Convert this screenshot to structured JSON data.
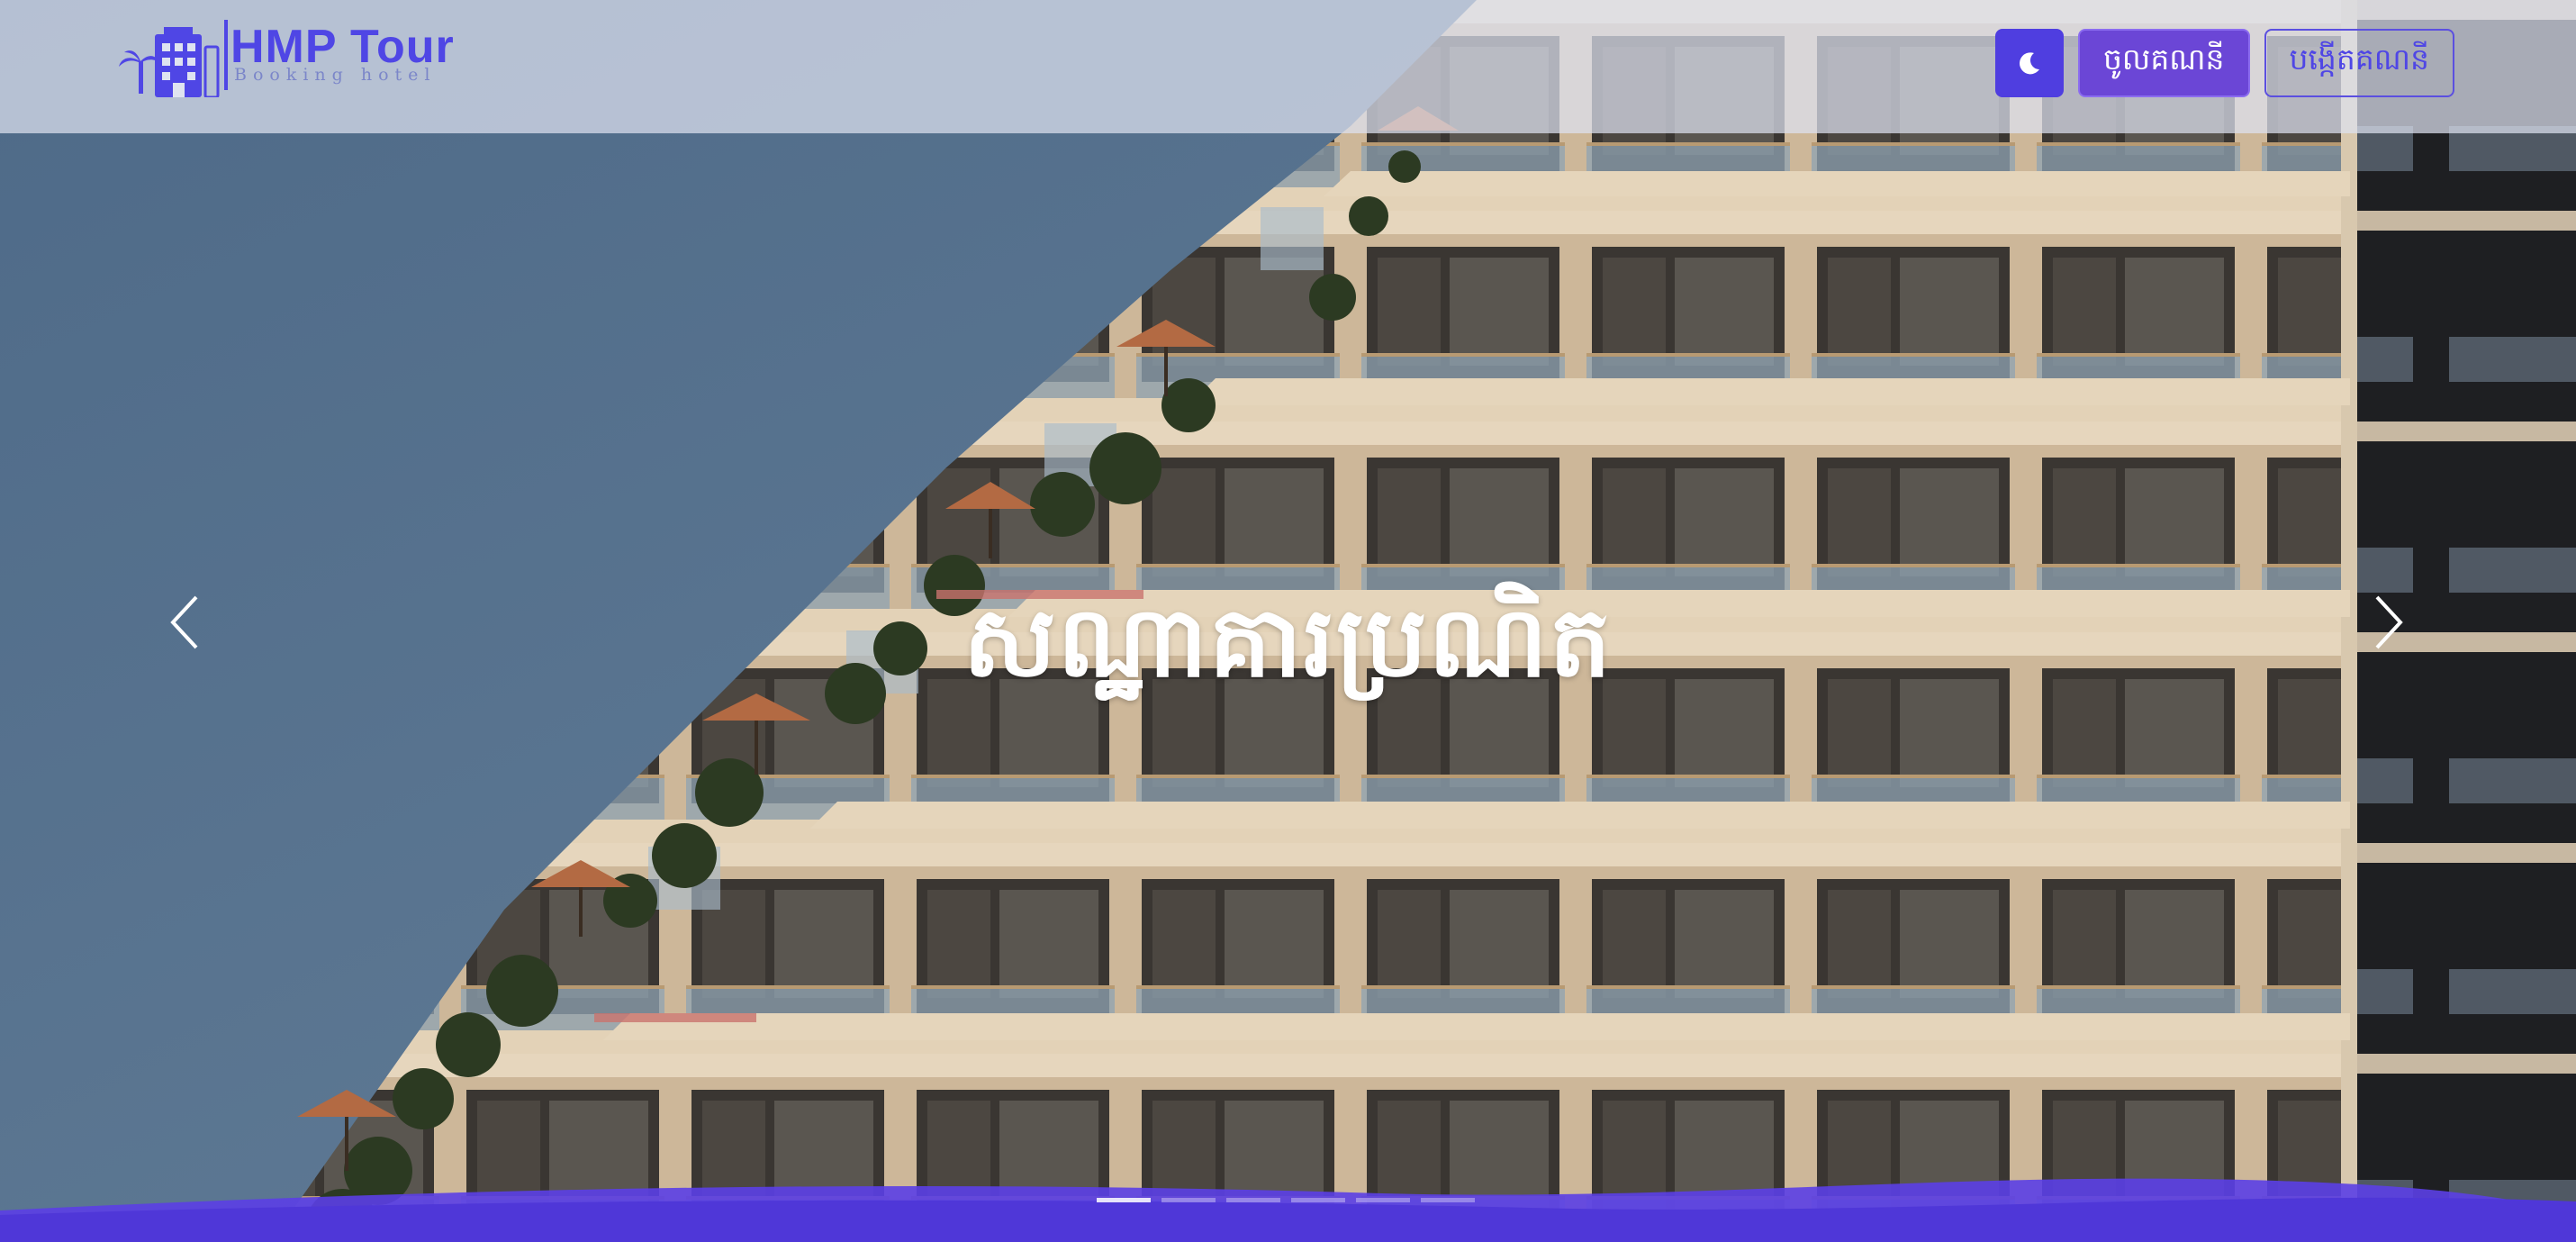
{
  "brand": {
    "title": "HMP Tour",
    "subtitle": "Booking hotel",
    "logo_icon": "hotel-building-palm-icon",
    "color": "#4f46e5"
  },
  "nav": {
    "theme_toggle_icon": "moon-icon",
    "login_label": "ចូលគណនី",
    "register_label": "បង្កើតគណនី"
  },
  "carousel": {
    "caption": "សណ្ឋាគារប្រណិត",
    "prev_icon": "chevron-left-icon",
    "next_icon": "chevron-right-icon",
    "indicator_count": 6,
    "active_index": 0
  },
  "colors": {
    "accent": "#4f46e5",
    "login_button": "#6b46d6",
    "wave": "#5b3fe6"
  }
}
